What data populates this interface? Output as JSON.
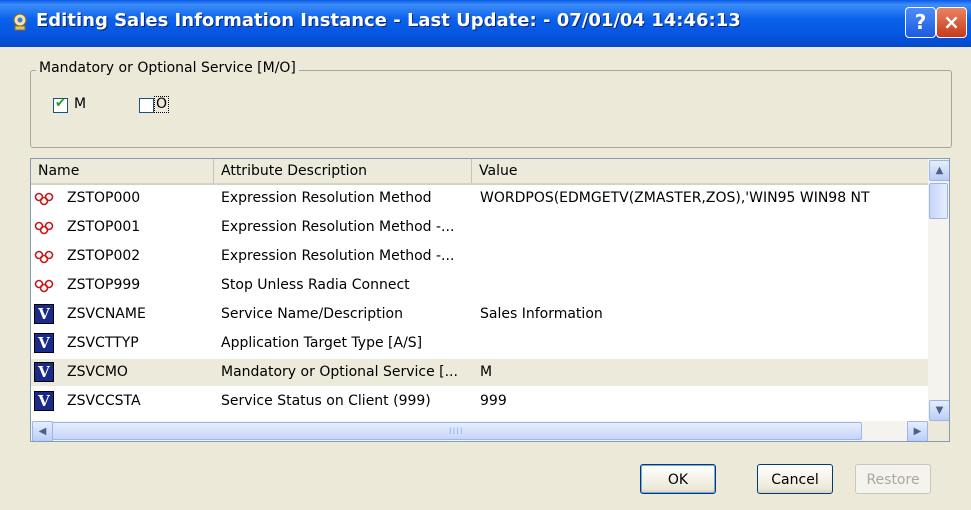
{
  "window": {
    "title": "Editing Sales Information Instance - Last Update: - 07/01/04 14:46:13",
    "help_label": "?",
    "close_label": "×"
  },
  "mandatory_group": {
    "label": "Mandatory or Optional Service [M/O]",
    "options": [
      {
        "label": "M",
        "checked": true
      },
      {
        "label": "O",
        "checked": false
      }
    ],
    "check_glyph": "✔"
  },
  "table": {
    "columns": [
      "Name",
      "Attribute Description",
      "Value"
    ],
    "rows": [
      {
        "icon": "stop-expression-icon",
        "name": "ZSTOP000",
        "desc": "Expression Resolution Method",
        "value": "WORDPOS(EDMGETV(ZMASTER,ZOS),'WIN95 WIN98 NT"
      },
      {
        "icon": "stop-expression-icon",
        "name": "ZSTOP001",
        "desc": "Expression Resolution Method -...",
        "value": ""
      },
      {
        "icon": "stop-expression-icon",
        "name": "ZSTOP002",
        "desc": "Expression Resolution Method -...",
        "value": ""
      },
      {
        "icon": "stop-expression-icon",
        "name": "ZSTOP999",
        "desc": "Stop Unless Radia Connect",
        "value": ""
      },
      {
        "icon": "variable-icon",
        "name": "ZSVCNAME",
        "desc": "Service Name/Description",
        "value": "Sales Information"
      },
      {
        "icon": "variable-icon",
        "name": "ZSVCTTYP",
        "desc": "Application Target Type [A/S]",
        "value": ""
      },
      {
        "icon": "variable-icon",
        "name": "ZSVCMO",
        "desc": "Mandatory or Optional Service [...",
        "value": "M",
        "selected": true
      },
      {
        "icon": "variable-icon",
        "name": "ZSVCCSTA",
        "desc": "Service Status on Client (999)",
        "value": "999"
      }
    ],
    "variable_icon_letter": "V"
  },
  "scrollbar": {
    "up_glyph": "▲",
    "down_glyph": "▼",
    "left_glyph": "◀",
    "right_glyph": "▶",
    "grip": "IIII"
  },
  "buttons": {
    "ok": "OK",
    "cancel": "Cancel",
    "restore": "Restore"
  },
  "colors": {
    "titlebar": "#0a5ae8",
    "selected_row": "#ebeadb",
    "stop_icon": "#c81818"
  }
}
